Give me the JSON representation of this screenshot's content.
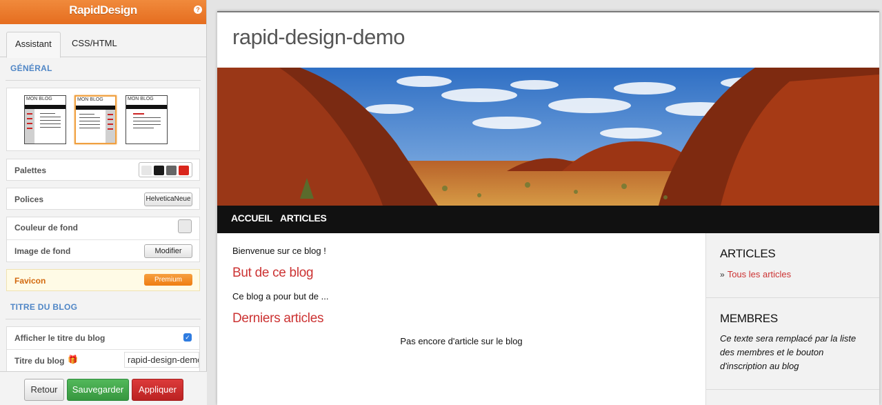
{
  "panel": {
    "app_title": "RapidDesign",
    "help_icon": "?",
    "tabs": [
      "Assistant",
      "CSS/HTML"
    ],
    "sections": {
      "general": "GÉNÉRAL",
      "blog_title": "TITRE DU BLOG"
    },
    "layouts": [
      {
        "label": "MON BLOG",
        "sidebar": "left",
        "selected": false
      },
      {
        "label": "MON BLOG",
        "sidebar": "right",
        "selected": true
      },
      {
        "label": "MON BLOG",
        "sidebar": "none",
        "selected": false
      }
    ],
    "rows": {
      "palettes": "Palettes",
      "palette_colors": [
        "#e6e6e6",
        "#1a1a1a",
        "#666666",
        "#d9261c"
      ],
      "fonts": "Polices",
      "font_value": "HelveticaNeue",
      "bg_color": "Couleur de fond",
      "bg_image": "Image de fond",
      "bg_image_button": "Modifier",
      "favicon": "Favicon",
      "favicon_button": "Premium",
      "show_title": "Afficher le titre du blog",
      "show_title_checked": true,
      "title_label": "Titre du blog",
      "title_value": "rapid-design-demo"
    },
    "footer": {
      "back": "Retour",
      "save": "Sauvegarder",
      "apply": "Appliquer"
    }
  },
  "preview": {
    "site_title": "rapid-design-demo",
    "nav": [
      "ACCUEIL",
      "ARTICLES"
    ],
    "main": {
      "welcome": "Bienvenue sur ce blog !",
      "heading_purpose": "But de ce blog",
      "purpose_text": "Ce blog a pour but de ...",
      "heading_latest": "Derniers articles",
      "empty_text": "Pas encore d'article sur le blog"
    },
    "sidebar": {
      "articles_title": "ARTICLES",
      "articles_link_bullet": "»",
      "articles_link": "Tous les articles",
      "members_title": "MEMBRES",
      "members_text": "Ce texte sera remplacé par la liste des membres et le bouton d'inscription au blog"
    },
    "colors": {
      "accent_orange": "#e56d1f",
      "link_red": "#cc3333",
      "nav_black": "#111111"
    }
  }
}
